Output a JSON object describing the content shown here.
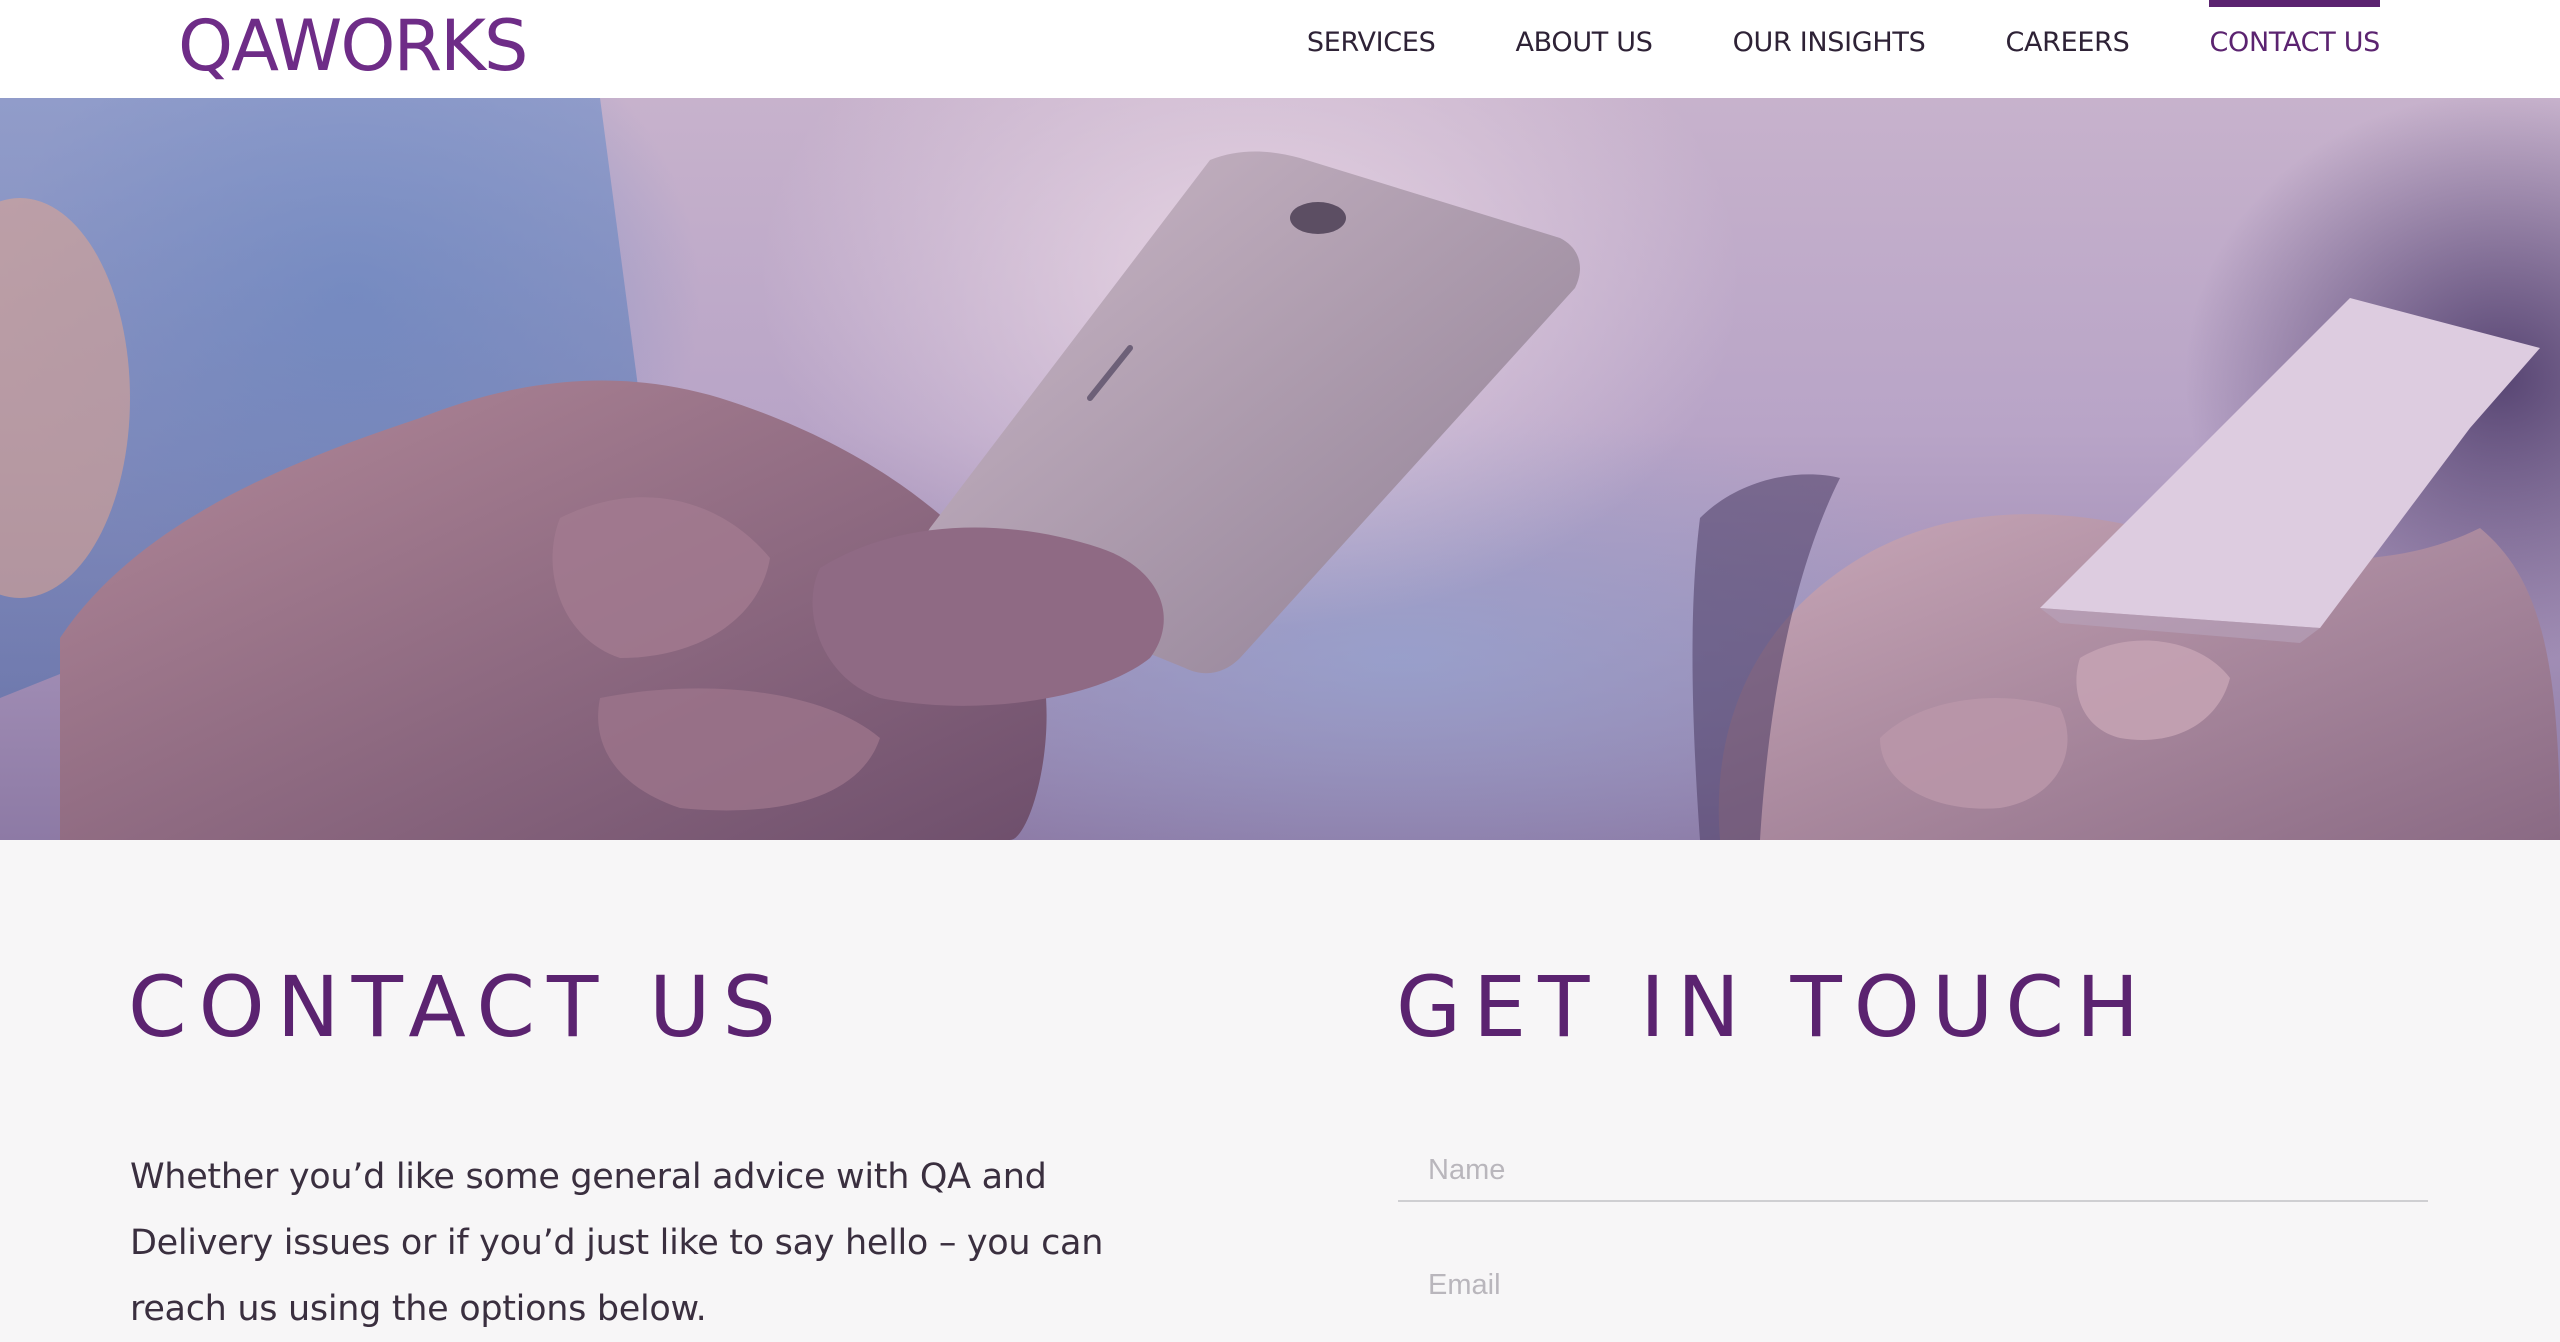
{
  "brand": {
    "logo_text": "QAWORKS",
    "accent": "#5b2370",
    "logo_color": "#6e2c87"
  },
  "nav": {
    "items": [
      {
        "label": "SERVICES"
      },
      {
        "label": "ABOUT US"
      },
      {
        "label": "OUR INSIGHTS"
      },
      {
        "label": "CAREERS"
      },
      {
        "label": "CONTACT US",
        "active": true
      }
    ]
  },
  "hero": {
    "image": "hands-holding-phone-and-card-photo"
  },
  "contact": {
    "title": "CONTACT US",
    "intro": "Whether you’d like some general advice with QA and Delivery issues or if you’d just like to say hello – you can reach us using the options below."
  },
  "form": {
    "title": "GET IN TOUCH",
    "name_placeholder": "Name",
    "email_placeholder": "Email"
  }
}
